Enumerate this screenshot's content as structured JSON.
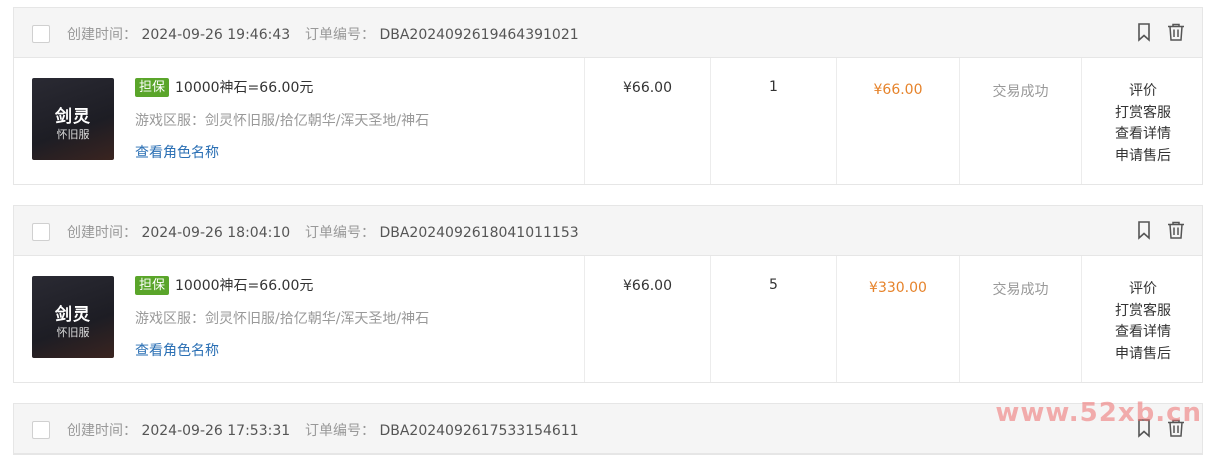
{
  "labels": {
    "created_time": "创建时间：",
    "order_no": "订单编号：",
    "badge": "担保",
    "server_prefix": "游戏区服：",
    "view_role": "查看角色名称"
  },
  "actions": [
    "评价",
    "打赏客服",
    "查看详情",
    "申请售后"
  ],
  "orders": [
    {
      "created": "2024-09-26 19:46:43",
      "order_no": "DBA2024092619464391021",
      "thumb_title": "剑灵",
      "thumb_sub": "怀旧服",
      "goods_title": "10000神石=66.00元",
      "server": "剑灵怀旧服/拾亿朝华/浑天圣地/神石",
      "unit_price": "¥66.00",
      "quantity": "1",
      "total": "¥66.00",
      "status": "交易成功"
    },
    {
      "created": "2024-09-26 18:04:10",
      "order_no": "DBA2024092618041011153",
      "thumb_title": "剑灵",
      "thumb_sub": "怀旧服",
      "goods_title": "10000神石=66.00元",
      "server": "剑灵怀旧服/拾亿朝华/浑天圣地/神石",
      "unit_price": "¥66.00",
      "quantity": "5",
      "total": "¥330.00",
      "status": "交易成功"
    },
    {
      "created": "2024-09-26 17:53:31",
      "order_no": "DBA2024092617533154611"
    }
  ],
  "watermark": "www.52xb.cn",
  "icons": {
    "bookmark": "bookmark-icon",
    "delete": "trash-icon"
  },
  "colors": {
    "badge": "#5aa52a",
    "total_price": "#e6832b",
    "link": "#2a6fb4"
  }
}
